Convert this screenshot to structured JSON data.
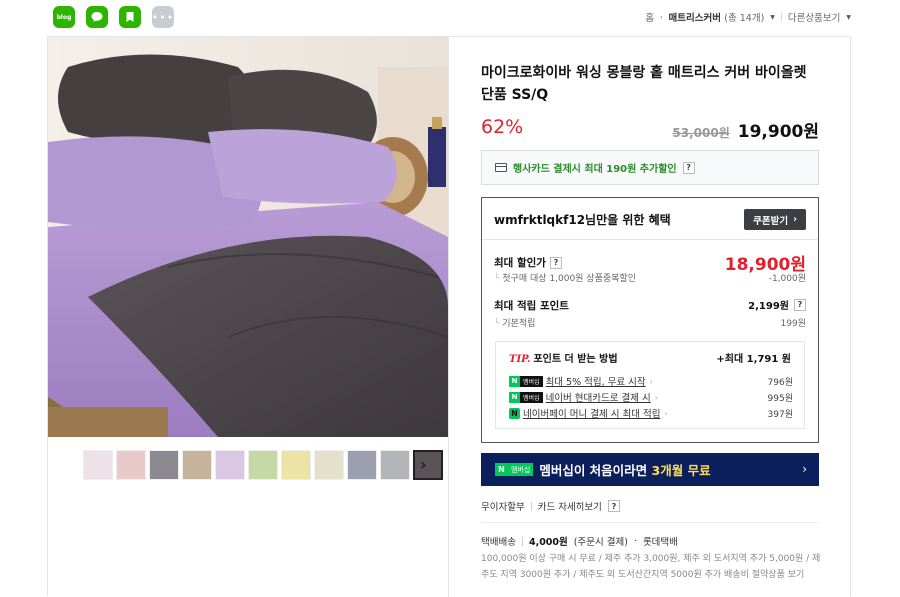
{
  "share": {
    "blog_label": "blog",
    "more_label": "•••"
  },
  "breadcrumb": {
    "home": "홈",
    "category": "매트리스커버",
    "count": "(총 14개)",
    "other": "다른상품보기"
  },
  "product": {
    "title": "마이크로화이바 워싱 몽블랑 홑 매트리스 커버 바이올렛 단품 SS/Q",
    "discount_rate": "62%",
    "original_price": "53,000원",
    "sale_price": "19,900원"
  },
  "card_promo": {
    "text": "행사카드 결제시 최대 190원 추가할인",
    "help": "?"
  },
  "benefit": {
    "title": "wmfrktlqkf12님만을 위한 혜택",
    "coupon_button": "쿠폰받기",
    "max_discount_label": "최대 할인가",
    "max_discount_price": "18,900원",
    "first_order_note": "첫구매 대상 1,000원 상품중복할인",
    "first_order_amount": "-1,000원",
    "max_point_label": "최대 적립 포인트",
    "max_point_value": "2,199원",
    "base_point_label": "기본적립",
    "base_point_value": "199원",
    "help": "?"
  },
  "tip": {
    "prefix": "TIP.",
    "title": "포인트 더 받는 방법",
    "total": "+최대 1,791 원",
    "rows": [
      {
        "badge": "멤버십",
        "label": "최대 5% 적립, 무료 시작",
        "amount": "796원"
      },
      {
        "badge": "멤버십",
        "label": "네이버 현대카드로 결제 시",
        "amount": "995원"
      },
      {
        "badge": "pay",
        "label": "네이버페이 머니 결제 시 최대 적립",
        "amount": "397원"
      }
    ]
  },
  "membership_banner": {
    "badge": "멤버십",
    "text_main": "멤버십이 처음이라면 ",
    "text_highlight": "3개월 무료"
  },
  "payment": {
    "installment": "무이자할부",
    "card_detail": "카드 자세히보기",
    "help": "?"
  },
  "shipping": {
    "label": "택배배송",
    "fee": "4,000원",
    "fee_note": "(주문시 결제)",
    "carrier": "롯데택배",
    "note": "100,000원 이상 구매 시 무료 / 제주 추가 3,000원, 제주 외 도서지역 추가 5,000원 / 제주도 지역 3000원 추가 / 제주도 외 도서산간지역 5000원 추가 배송비 절약상품 보기"
  },
  "colors": {
    "accent_red": "#e0212e",
    "naver_green": "#03c75a",
    "banner_navy": "#0a1f5b",
    "bedding_lavender": "#a98bc9",
    "bedding_charcoal": "#4a4448"
  },
  "thumbnails": [
    {
      "color": "#ece2e8",
      "name": "thumb-1"
    },
    {
      "color": "#e9c9c9",
      "name": "thumb-2"
    },
    {
      "color": "#8b8890",
      "name": "thumb-3"
    },
    {
      "color": "#c7b39b",
      "name": "thumb-4"
    },
    {
      "color": "#d9c7e4",
      "name": "thumb-5"
    },
    {
      "color": "#c4d9a6",
      "name": "thumb-6"
    },
    {
      "color": "#ede3a6",
      "name": "thumb-7"
    },
    {
      "color": "#e3e0cc",
      "name": "thumb-8"
    },
    {
      "color": "#9c9fb0",
      "name": "thumb-9"
    },
    {
      "color": "#b3b5b8",
      "name": "thumb-10"
    },
    {
      "color": "#5a5357",
      "name": "thumb-11"
    }
  ]
}
